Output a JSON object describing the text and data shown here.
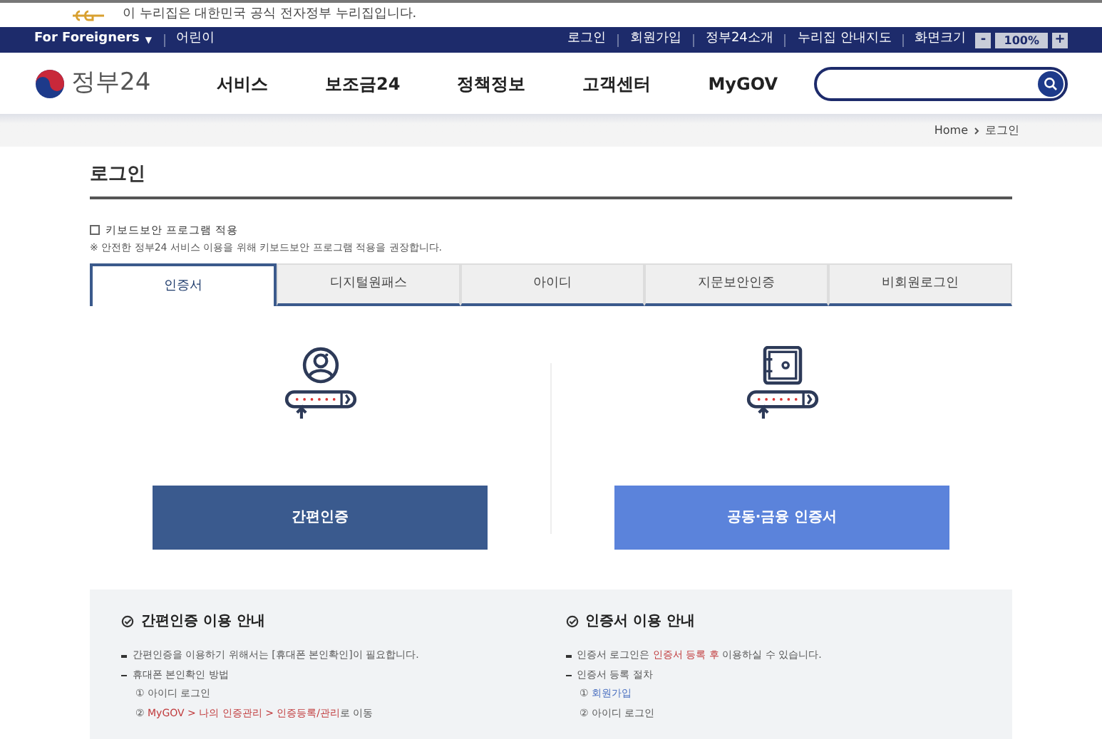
{
  "notice": {
    "text": "이 누리집은 대한민국 공식 전자정부 누리집입니다."
  },
  "utility_bar": {
    "language": "For Foreigners",
    "language_caret": "▼",
    "left_links": [
      "어린이"
    ],
    "right_links": [
      "로그인",
      "회원가입",
      "정부24소개",
      "누리집 안내지도"
    ],
    "zoom_label": "화면크기",
    "zoom_minus": "-",
    "zoom_value": "100%",
    "zoom_plus": "+"
  },
  "header": {
    "logo_text": "정부24",
    "nav": [
      "서비스",
      "보조금24",
      "정책정보",
      "고객센터",
      "MyGOV"
    ]
  },
  "breadcrumb": [
    "Home",
    "로그인"
  ],
  "page_title": "로그인",
  "keyboard_security": {
    "label": "키보드보안 프로그램 적용",
    "checked": false,
    "note": "※ 안전한 정부24 서비스 이용을 위해 키보드보안 프로그램 적용을 권장합니다."
  },
  "tabs": [
    {
      "label": "인증서",
      "selected": true
    },
    {
      "label": "디지털원패스",
      "selected": false
    },
    {
      "label": "아이디",
      "selected": false
    },
    {
      "label": "지문보안인증",
      "selected": false
    },
    {
      "label": "비회원로그인",
      "selected": false
    }
  ],
  "login_options": [
    {
      "kind": "simple",
      "button": "간편인증"
    },
    {
      "kind": "certificate",
      "button": "공동·금융 인증서"
    }
  ],
  "guides": [
    {
      "title": "간편인증 이용 안내",
      "lines": [
        {
          "kind": "bullet",
          "parts": [
            {
              "text": "간편인증을 이용하기 위해서는 [휴대폰 본인확인]이 필요합니다."
            }
          ]
        },
        {
          "kind": "bullet",
          "parts": [
            {
              "text": "휴대폰 본인확인 방법"
            }
          ]
        },
        {
          "kind": "step",
          "parts": [
            {
              "text": "① 아이디 로그인"
            }
          ]
        },
        {
          "kind": "step",
          "parts": [
            {
              "text": "② "
            },
            {
              "text": "MyGOV > 나의 인증관리 > 인증등록/관리",
              "color": "#c0393b"
            },
            {
              "text": "로 이동"
            }
          ]
        }
      ]
    },
    {
      "title": "인증서 이용 안내",
      "lines": [
        {
          "kind": "bullet",
          "parts": [
            {
              "text": "인증서 로그인은 "
            },
            {
              "text": "인증서 등록 후",
              "color": "#c0393b"
            },
            {
              "text": " 이용하실 수 있습니다."
            }
          ]
        },
        {
          "kind": "bullet",
          "parts": [
            {
              "text": "인증서 등록 절차"
            }
          ]
        },
        {
          "kind": "step",
          "parts": [
            {
              "text": "① "
            },
            {
              "text": "회원가입",
              "color": "#4a6fc0"
            }
          ]
        },
        {
          "kind": "step",
          "parts": [
            {
              "text": "② 아이디 로그인"
            }
          ]
        }
      ]
    }
  ]
}
